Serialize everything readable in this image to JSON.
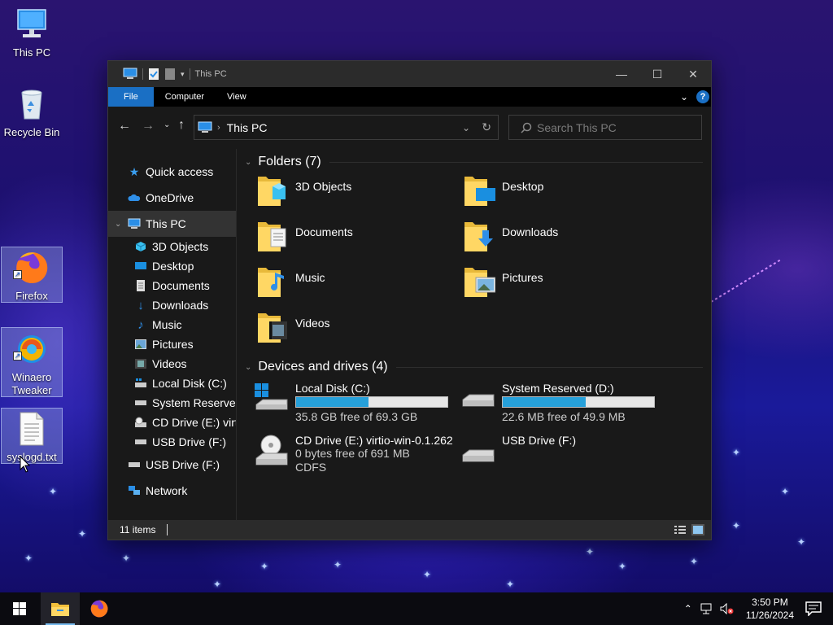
{
  "desktop": {
    "icons": [
      {
        "label": "This PC",
        "icon": "this-pc-icon"
      },
      {
        "label": "Recycle Bin",
        "icon": "recycle-bin-icon"
      },
      {
        "label": "Firefox",
        "icon": "firefox-icon",
        "shortcut": true
      },
      {
        "label": "Winaero Tweaker",
        "icon": "winaero-tweaker-icon",
        "shortcut": true
      },
      {
        "label": "syslogd.txt",
        "icon": "text-file-icon"
      }
    ]
  },
  "window": {
    "title": "This PC",
    "controls": {
      "minimize": "—",
      "maximize": "☐",
      "close": "✕"
    }
  },
  "ribbon": {
    "tabs": [
      "File",
      "Computer",
      "View"
    ],
    "help": "?"
  },
  "address": {
    "path": "This PC",
    "search_placeholder": "Search This PC"
  },
  "nav": {
    "quick_access": "Quick access",
    "onedrive": "OneDrive",
    "this_pc": "This PC",
    "children": [
      "3D Objects",
      "Desktop",
      "Documents",
      "Downloads",
      "Music",
      "Pictures",
      "Videos",
      "Local Disk (C:)",
      "System Reserved",
      "CD Drive (E:) virtio",
      "USB Drive (F:)"
    ],
    "usb": "USB Drive (F:)",
    "network": "Network"
  },
  "folders": {
    "header": "Folders (7)",
    "items": [
      "3D Objects",
      "Desktop",
      "Documents",
      "Downloads",
      "Music",
      "Pictures",
      "Videos"
    ]
  },
  "drives": {
    "header": "Devices and drives (4)",
    "items": [
      {
        "name": "Local Disk (C:)",
        "free": "35.8 GB free of 69.3 GB",
        "used_fraction": 0.48,
        "icon": "windows-drive-icon"
      },
      {
        "name": "System Reserved (D:)",
        "free": "22.6 MB free of 49.9 MB",
        "used_fraction": 0.55,
        "icon": "hard-drive-icon"
      },
      {
        "name": "CD Drive (E:) virtio-win-0.1.262",
        "free": "0 bytes free of 691 MB",
        "fs": "CDFS",
        "icon": "cd-drive-icon"
      },
      {
        "name": "USB Drive (F:)",
        "icon": "usb-drive-icon"
      }
    ]
  },
  "status": {
    "items": "11 items"
  },
  "taskbar": {
    "time": "3:50 PM",
    "date": "11/26/2024"
  },
  "colors": {
    "accent": "#1a6fc4",
    "drive_bar": "#26a0da",
    "window_bg": "#191919"
  }
}
